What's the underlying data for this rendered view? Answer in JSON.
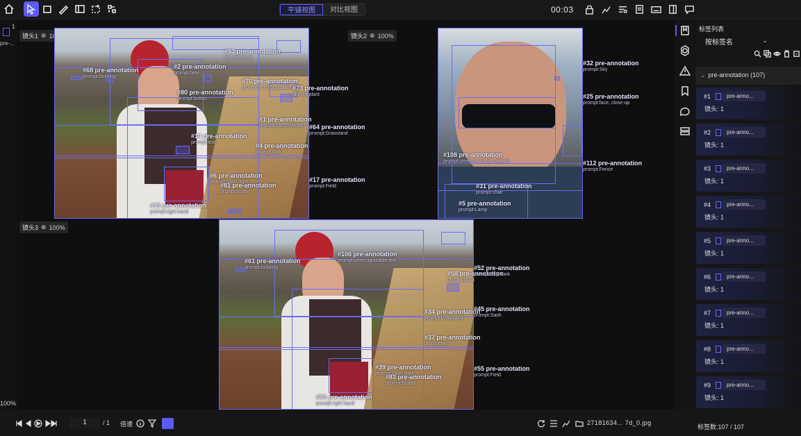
{
  "toolbar": {
    "view_modes": [
      "平铺视图",
      "对比视图"
    ],
    "active_view": "平铺视图",
    "timer": "00:03"
  },
  "left": {
    "thumb_number": "1",
    "thumb_name": "pre-...",
    "zoom": "100%"
  },
  "views": [
    {
      "lens": "镜头1",
      "zoom": "100%"
    },
    {
      "lens": "镜头2",
      "zoom": "100%"
    },
    {
      "lens": "镜头3",
      "zoom": "100%"
    }
  ],
  "annotations_v1": [
    {
      "t": "#68 pre-annotation",
      "p": "prompt:building"
    },
    {
      "t": "#93 pre-annotation",
      "p": "prompt:hand"
    },
    {
      "t": "#2 pre-annotation",
      "p": "prompt:face"
    },
    {
      "t": "#80 pre-annotation",
      "p": "prompt:button"
    },
    {
      "t": "#14 pre-annotation",
      "p": "prompt:test"
    },
    {
      "t": "#6 pre-annotation",
      "p": "prompt:sash, light"
    },
    {
      "t": "#81 pre-annotation",
      "p": "prompt:button"
    },
    {
      "t": "#15 pre-annotation",
      "p": "prompt:right hand"
    },
    {
      "t": "#1 pre-annotation",
      "p": "prompt:hat, covered"
    },
    {
      "t": "#64 pre-annotation",
      "p": "prompt:Grassland"
    },
    {
      "t": "#17 pre-annotation",
      "p": "prompt:Field"
    },
    {
      "t": "#70 pre-annotation",
      "p": "prompt:unrecognizable text"
    },
    {
      "t": "#73 pre-annotation",
      "p": "prompt:plant"
    },
    {
      "t": "#4 pre-annotation",
      "p": "prompt:dark"
    }
  ],
  "annotations_v2": [
    {
      "t": "#32 pre-annotation",
      "p": "prompt:Sky"
    },
    {
      "t": "#25 pre-annotation",
      "p": "prompt:face, close-up"
    },
    {
      "t": "#108 pre-annotation",
      "p": "prompt:unrecognizable objects"
    },
    {
      "t": "#112 pre-annotation",
      "p": "prompt:Fence"
    },
    {
      "t": "#31 pre-annotation",
      "p": "prompt:chair"
    },
    {
      "t": "#5 pre-annotation",
      "p": "prompt:Lamp"
    }
  ],
  "annotations_v3": [
    {
      "t": "#61 pre-annotation",
      "p": "prompt:building"
    },
    {
      "t": "#106 pre-annotation",
      "p": "prompt:unrecognizable text"
    },
    {
      "t": "#58 pre-annotation",
      "p": "prompt:plant"
    },
    {
      "t": "#52 pre-annotation",
      "p": "prompt:Sky, dark"
    },
    {
      "t": "#34 pre-annotation",
      "p": "prompt:Grassland"
    },
    {
      "t": "#45 pre-annotation",
      "p": "prompt:Sash"
    },
    {
      "t": "#37 pre-annotation",
      "p": "prompt:test"
    },
    {
      "t": "#39 pre-annotation",
      "p": "prompt:sash, dark"
    },
    {
      "t": "#55 pre-annotation",
      "p": "prompt:Field"
    },
    {
      "t": "#50 pre-annotation",
      "p": "prompt:right hand"
    },
    {
      "t": "#83 pre-annotation",
      "p": "prompt:button"
    }
  ],
  "panel": {
    "title": "标签列表",
    "sort": "按标签名",
    "group_label": "pre-annotation (107)",
    "items": [
      {
        "num": "#1",
        "name": "pre-anno...",
        "lens": "镜头: 1"
      },
      {
        "num": "#2",
        "name": "pre-anno...",
        "lens": "镜头: 1"
      },
      {
        "num": "#3",
        "name": "pre-anno...",
        "lens": "镜头: 1"
      },
      {
        "num": "#4",
        "name": "pre-anno...",
        "lens": "镜头: 1"
      },
      {
        "num": "#5",
        "name": "pre-anno...",
        "lens": "镜头: 1"
      },
      {
        "num": "#6",
        "name": "pre-anno...",
        "lens": "镜头: 1"
      },
      {
        "num": "#7",
        "name": "pre-anno...",
        "lens": "镜头: 1"
      },
      {
        "num": "#8",
        "name": "pre-anno...",
        "lens": "镜头: 1"
      },
      {
        "num": "#9",
        "name": "pre-anno...",
        "lens": "镜头: 1"
      }
    ],
    "footer": "标签数:107 / 107"
  },
  "bottom": {
    "page_current": "1",
    "page_total": "/ 1",
    "speed_label": "倍速",
    "filename": "27181634... 7d_0.jpg"
  },
  "colors": {
    "accent": "#5b5cf6",
    "box": "#6a6cf5"
  }
}
